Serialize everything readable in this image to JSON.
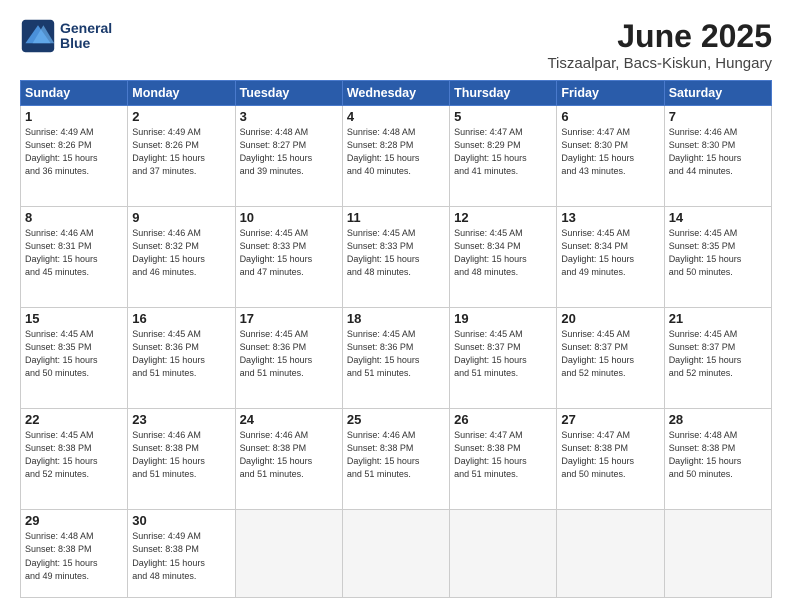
{
  "logo": {
    "line1": "General",
    "line2": "Blue"
  },
  "title": "June 2025",
  "subtitle": "Tiszaalpar, Bacs-Kiskun, Hungary",
  "header_days": [
    "Sunday",
    "Monday",
    "Tuesday",
    "Wednesday",
    "Thursday",
    "Friday",
    "Saturday"
  ],
  "weeks": [
    [
      {
        "day": "1",
        "info": "Sunrise: 4:49 AM\nSunset: 8:26 PM\nDaylight: 15 hours\nand 36 minutes."
      },
      {
        "day": "2",
        "info": "Sunrise: 4:49 AM\nSunset: 8:26 PM\nDaylight: 15 hours\nand 37 minutes."
      },
      {
        "day": "3",
        "info": "Sunrise: 4:48 AM\nSunset: 8:27 PM\nDaylight: 15 hours\nand 39 minutes."
      },
      {
        "day": "4",
        "info": "Sunrise: 4:48 AM\nSunset: 8:28 PM\nDaylight: 15 hours\nand 40 minutes."
      },
      {
        "day": "5",
        "info": "Sunrise: 4:47 AM\nSunset: 8:29 PM\nDaylight: 15 hours\nand 41 minutes."
      },
      {
        "day": "6",
        "info": "Sunrise: 4:47 AM\nSunset: 8:30 PM\nDaylight: 15 hours\nand 43 minutes."
      },
      {
        "day": "7",
        "info": "Sunrise: 4:46 AM\nSunset: 8:30 PM\nDaylight: 15 hours\nand 44 minutes."
      }
    ],
    [
      {
        "day": "8",
        "info": "Sunrise: 4:46 AM\nSunset: 8:31 PM\nDaylight: 15 hours\nand 45 minutes."
      },
      {
        "day": "9",
        "info": "Sunrise: 4:46 AM\nSunset: 8:32 PM\nDaylight: 15 hours\nand 46 minutes."
      },
      {
        "day": "10",
        "info": "Sunrise: 4:45 AM\nSunset: 8:33 PM\nDaylight: 15 hours\nand 47 minutes."
      },
      {
        "day": "11",
        "info": "Sunrise: 4:45 AM\nSunset: 8:33 PM\nDaylight: 15 hours\nand 48 minutes."
      },
      {
        "day": "12",
        "info": "Sunrise: 4:45 AM\nSunset: 8:34 PM\nDaylight: 15 hours\nand 48 minutes."
      },
      {
        "day": "13",
        "info": "Sunrise: 4:45 AM\nSunset: 8:34 PM\nDaylight: 15 hours\nand 49 minutes."
      },
      {
        "day": "14",
        "info": "Sunrise: 4:45 AM\nSunset: 8:35 PM\nDaylight: 15 hours\nand 50 minutes."
      }
    ],
    [
      {
        "day": "15",
        "info": "Sunrise: 4:45 AM\nSunset: 8:35 PM\nDaylight: 15 hours\nand 50 minutes."
      },
      {
        "day": "16",
        "info": "Sunrise: 4:45 AM\nSunset: 8:36 PM\nDaylight: 15 hours\nand 51 minutes."
      },
      {
        "day": "17",
        "info": "Sunrise: 4:45 AM\nSunset: 8:36 PM\nDaylight: 15 hours\nand 51 minutes."
      },
      {
        "day": "18",
        "info": "Sunrise: 4:45 AM\nSunset: 8:36 PM\nDaylight: 15 hours\nand 51 minutes."
      },
      {
        "day": "19",
        "info": "Sunrise: 4:45 AM\nSunset: 8:37 PM\nDaylight: 15 hours\nand 51 minutes."
      },
      {
        "day": "20",
        "info": "Sunrise: 4:45 AM\nSunset: 8:37 PM\nDaylight: 15 hours\nand 52 minutes."
      },
      {
        "day": "21",
        "info": "Sunrise: 4:45 AM\nSunset: 8:37 PM\nDaylight: 15 hours\nand 52 minutes."
      }
    ],
    [
      {
        "day": "22",
        "info": "Sunrise: 4:45 AM\nSunset: 8:38 PM\nDaylight: 15 hours\nand 52 minutes."
      },
      {
        "day": "23",
        "info": "Sunrise: 4:46 AM\nSunset: 8:38 PM\nDaylight: 15 hours\nand 51 minutes."
      },
      {
        "day": "24",
        "info": "Sunrise: 4:46 AM\nSunset: 8:38 PM\nDaylight: 15 hours\nand 51 minutes."
      },
      {
        "day": "25",
        "info": "Sunrise: 4:46 AM\nSunset: 8:38 PM\nDaylight: 15 hours\nand 51 minutes."
      },
      {
        "day": "26",
        "info": "Sunrise: 4:47 AM\nSunset: 8:38 PM\nDaylight: 15 hours\nand 51 minutes."
      },
      {
        "day": "27",
        "info": "Sunrise: 4:47 AM\nSunset: 8:38 PM\nDaylight: 15 hours\nand 50 minutes."
      },
      {
        "day": "28",
        "info": "Sunrise: 4:48 AM\nSunset: 8:38 PM\nDaylight: 15 hours\nand 50 minutes."
      }
    ],
    [
      {
        "day": "29",
        "info": "Sunrise: 4:48 AM\nSunset: 8:38 PM\nDaylight: 15 hours\nand 49 minutes."
      },
      {
        "day": "30",
        "info": "Sunrise: 4:49 AM\nSunset: 8:38 PM\nDaylight: 15 hours\nand 48 minutes."
      },
      {
        "day": "",
        "info": ""
      },
      {
        "day": "",
        "info": ""
      },
      {
        "day": "",
        "info": ""
      },
      {
        "day": "",
        "info": ""
      },
      {
        "day": "",
        "info": ""
      }
    ]
  ]
}
